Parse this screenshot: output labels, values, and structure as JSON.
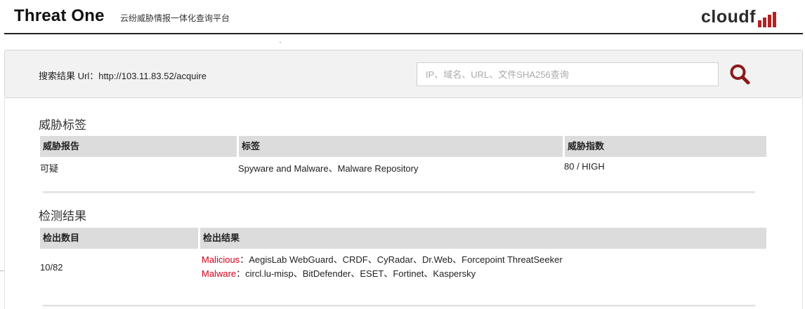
{
  "header": {
    "title": "Threat One",
    "subtitle": "云纷威胁情报一体化查询平台",
    "logo_text": "cloudf",
    "logo_accent": "#b22222"
  },
  "search": {
    "result_label": "搜索结果 Url：http://103.11.83.52/acquire",
    "placeholder": "IP、域名、URL、文件SHA256查询",
    "value": "",
    "button_icon": "search-icon",
    "icon_color": "#8b1a1a"
  },
  "threat_tags": {
    "title": "威胁标签",
    "columns": [
      "威胁报告",
      "标签",
      "威胁指数"
    ],
    "row": {
      "report": "可疑",
      "tags": "Spyware and Malware、Malware Repository",
      "index": "80 / HIGH"
    }
  },
  "detection": {
    "title": "检测结果",
    "columns": [
      "检出数目",
      "检出结果"
    ],
    "count": "10/82",
    "malicious_label": "Malicious",
    "malicious_engines": "：AegisLab WebGuard、CRDF、CyRadar、Dr.Web、Forcepoint ThreatSeeker",
    "malware_label": "Malware",
    "malware_engines": "：circl.lu-misp、BitDefender、ESET、Fortinet、Kaspersky",
    "label_color": "#d0021b"
  }
}
